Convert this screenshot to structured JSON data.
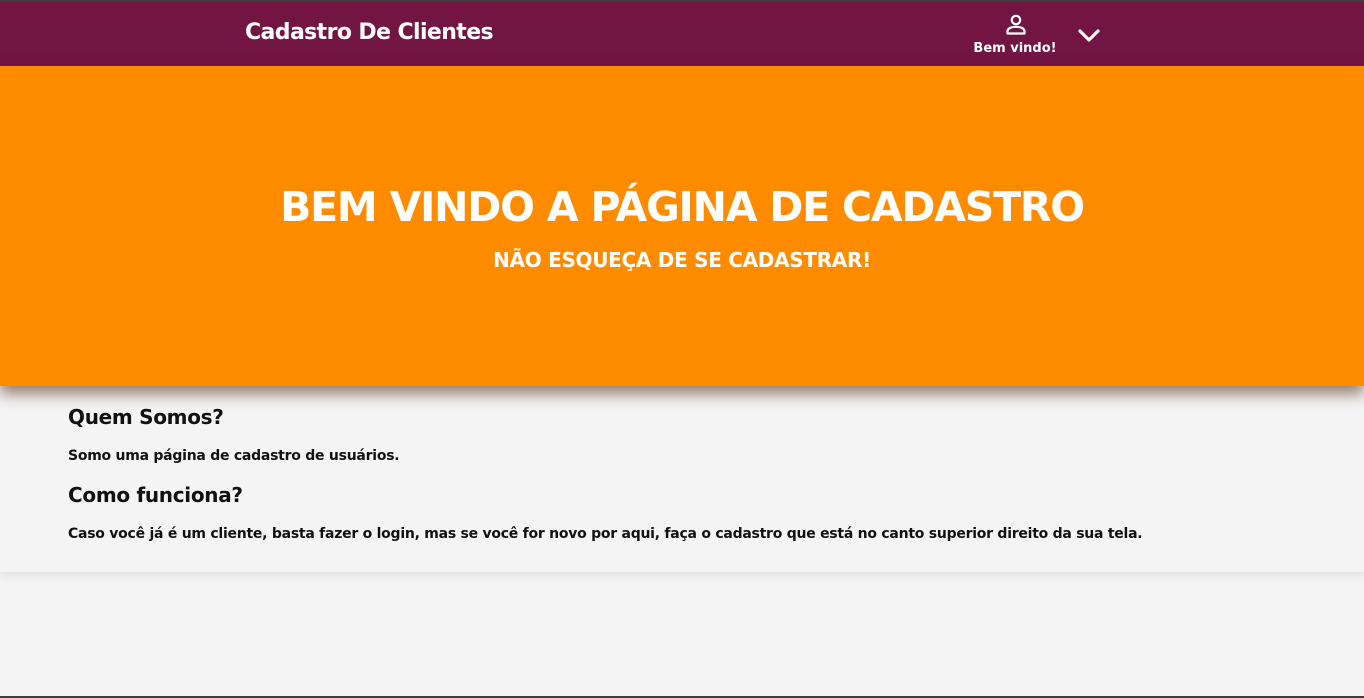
{
  "navbar": {
    "brand": "Cadastro De Clientes",
    "user_label": "Bem vindo!",
    "user_icon": "person-icon",
    "menu_icon": "chevron-down-icon",
    "background_color": "#731542"
  },
  "hero": {
    "title": "BEM VINDO A PÁGINA DE CADASTRO",
    "subtitle": "NÃO ESQUEÇA DE SE CADASTRAR!",
    "background_color": "#ff8c00"
  },
  "about": {
    "title": "Quem Somos?",
    "text": "Somo uma página de cadastro de usuários."
  },
  "how_it_works": {
    "title": "Como funciona?",
    "text": "Caso você já é um cliente, basta fazer o login, mas se você for novo por aqui, faça o cadastro que está no canto superior direito da sua tela."
  }
}
